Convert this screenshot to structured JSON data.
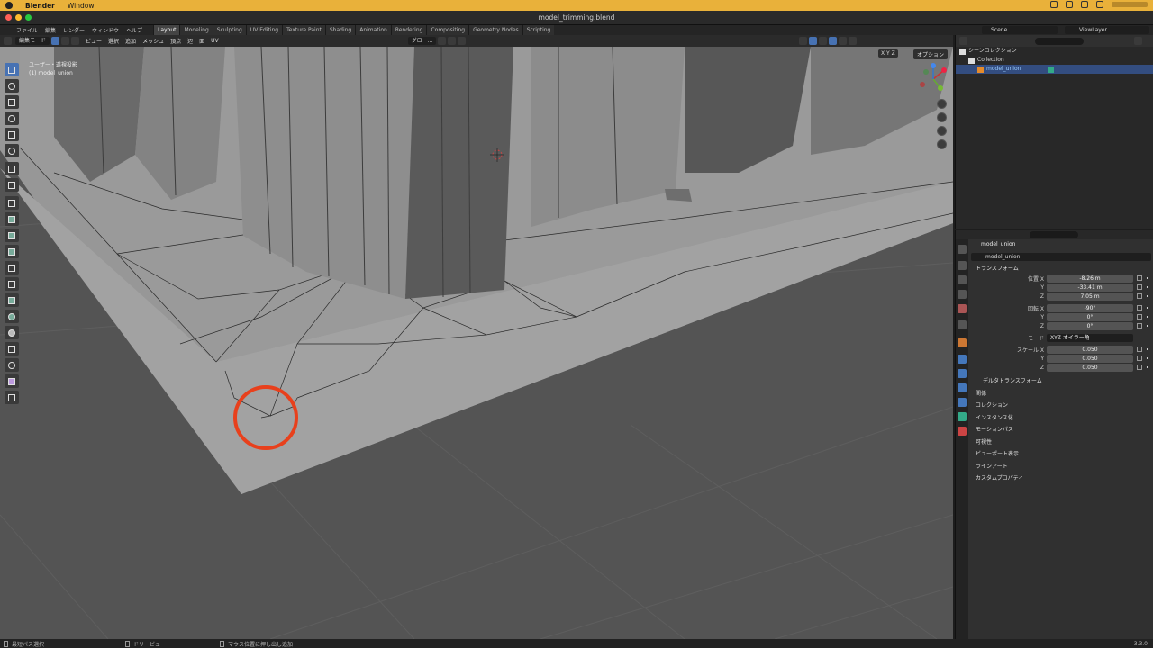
{
  "menubar": {
    "app": "Blender",
    "items": [
      "Window"
    ]
  },
  "window": {
    "title": "model_trimming.blend"
  },
  "topbar": {
    "menus": [
      "ファイル",
      "編集",
      "レンダー",
      "ウィンドウ",
      "ヘルプ"
    ],
    "workspaces": [
      "Layout",
      "Modeling",
      "Sculpting",
      "UV Editing",
      "Texture Paint",
      "Shading",
      "Animation",
      "Rendering",
      "Compositing",
      "Geometry Nodes",
      "Scripting"
    ],
    "active_workspace": "Layout",
    "scene": "Scene",
    "view_layer": "ViewLayer"
  },
  "viewport_header": {
    "mode": "編集モード",
    "menus": [
      "ビュー",
      "選択",
      "追加",
      "メッシュ",
      "頂点",
      "辺",
      "面",
      "UV"
    ],
    "transform_orientation": "グロー..."
  },
  "viewport": {
    "view_label": "ユーザー・透視投影",
    "object_label": "(1) model_union",
    "options": "オプション",
    "axes": "X Y Z"
  },
  "outliner": {
    "scene_collection": "シーンコレクション",
    "collection": "Collection",
    "object": "model_union"
  },
  "properties": {
    "object_name": "model_union",
    "object_field": "model_union",
    "transform_header": "トランスフォーム",
    "location_label": "位置 X",
    "location": [
      "-8.26 m",
      "-33.41 m",
      "7.05 m"
    ],
    "rotation_label": "回転 X",
    "rotation": [
      "-90°",
      "0°",
      "0°"
    ],
    "mode_label": "モード",
    "mode_value": "XYZ オイラー角",
    "scale_label": "スケール X",
    "scale": [
      "0.050",
      "0.050",
      "0.050"
    ],
    "axis_y": "Y",
    "axis_z": "Z",
    "delta": "デルタトランスフォーム",
    "sections": [
      "関係",
      "コレクション",
      "インスタンス化",
      "モーションパス",
      "可視性",
      "ビューポート表示",
      "ラインアート",
      "カスタムプロパティ"
    ]
  },
  "statusbar": {
    "items": [
      "最短パス選択",
      "ドリービュー",
      "マウス位置に押し出し追加"
    ],
    "version": "3.3.0"
  },
  "colors": {
    "menubar": "#e9b13a",
    "selection": "#4772b3",
    "highlight_circle": "#e8401c"
  }
}
